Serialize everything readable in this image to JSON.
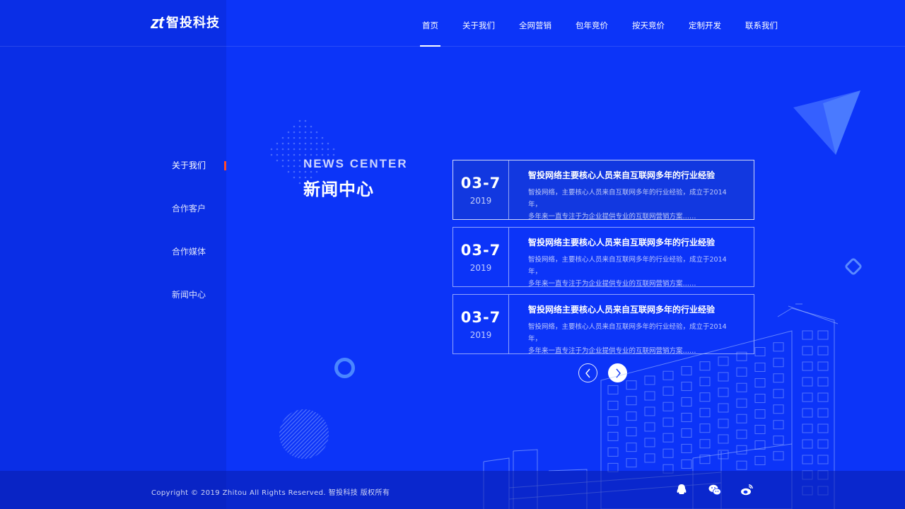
{
  "brand": {
    "mark": "zt",
    "name": "智投科技"
  },
  "nav": {
    "items": [
      {
        "label": "首页",
        "active": true
      },
      {
        "label": "关于我们"
      },
      {
        "label": "全网营销"
      },
      {
        "label": "包年竞价"
      },
      {
        "label": "按天竞价"
      },
      {
        "label": "定制开发"
      },
      {
        "label": "联系我们"
      }
    ]
  },
  "sidebar": {
    "items": [
      {
        "label": "关于我们",
        "active": true
      },
      {
        "label": "合作客户"
      },
      {
        "label": "合作媒体"
      },
      {
        "label": "新闻中心"
      }
    ]
  },
  "section": {
    "en_title": "NEWS CENTER",
    "cn_title": "新闻中心"
  },
  "news": [
    {
      "day": "03-7",
      "year": "2019",
      "title": "智投网络主要核心人员来自互联网多年的行业经验",
      "desc_line1": "智投网络，主要核心人员来自互联网多年的行业经验，成立于2014年，",
      "desc_line2": "多年来一直专注于为企业提供专业的互联网营销方案……"
    },
    {
      "day": "03-7",
      "year": "2019",
      "title": "智投网络主要核心人员来自互联网多年的行业经验",
      "desc_line1": "智投网络，主要核心人员来自互联网多年的行业经验，成立于2014年，",
      "desc_line2": "多年来一直专注于为企业提供专业的互联网营销方案……"
    },
    {
      "day": "03-7",
      "year": "2019",
      "title": "智投网络主要核心人员来自互联网多年的行业经验",
      "desc_line1": "智投网络，主要核心人员来自互联网多年的行业经验，成立于2014年，",
      "desc_line2": "多年来一直专注于为企业提供专业的互联网营销方案……"
    }
  ],
  "footer": {
    "copyright": "Copyright © 2019 Zhitou All Rights Reserved. 智投科技 版权所有",
    "social_icons": [
      "qq-icon",
      "wechat-icon",
      "weibo-icon"
    ]
  },
  "colors": {
    "background": "#0c34f8",
    "left_panel": "#0a2ee6",
    "accent": "#ff4a2a"
  }
}
